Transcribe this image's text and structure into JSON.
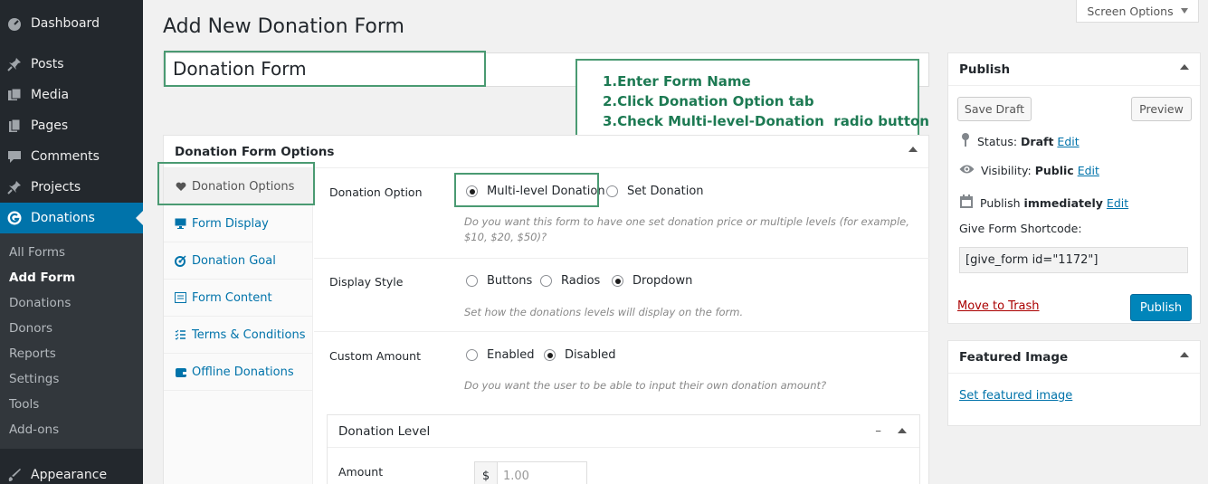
{
  "sidebar": {
    "items": [
      {
        "label": "Dashboard",
        "icon": "dashboard-icon"
      },
      {
        "label": "Posts",
        "icon": "pin-icon"
      },
      {
        "label": "Media",
        "icon": "media-icon"
      },
      {
        "label": "Pages",
        "icon": "pages-icon"
      },
      {
        "label": "Comments",
        "icon": "comments-icon"
      },
      {
        "label": "Projects",
        "icon": "pin-icon"
      },
      {
        "label": "Donations",
        "icon": "give-icon"
      },
      {
        "label": "Appearance",
        "icon": "appearance-icon"
      }
    ],
    "submenu": [
      "All Forms",
      "Add Form",
      "Donations",
      "Donors",
      "Reports",
      "Settings",
      "Tools",
      "Add-ons"
    ],
    "active_color": "#0073aa"
  },
  "header": {
    "title": "Add New Donation Form",
    "screen_options": "Screen Options"
  },
  "form_title": {
    "value": "Donation Form"
  },
  "callout": {
    "lines": [
      "1.Enter Form Name",
      "2.Click Donation Option tab",
      "3.Check Multi-level-Donation  radio button"
    ],
    "border_color": "#4a9a72"
  },
  "options_box": {
    "title": "Donation Form Options",
    "tabs": [
      {
        "label": "Donation Options",
        "icon": "heart-icon"
      },
      {
        "label": "Form Display",
        "icon": "display-icon"
      },
      {
        "label": "Donation Goal",
        "icon": "goal-icon"
      },
      {
        "label": "Form Content",
        "icon": "content-icon"
      },
      {
        "label": "Terms & Conditions",
        "icon": "list-icon"
      },
      {
        "label": "Offline Donations",
        "icon": "wallet-icon"
      }
    ],
    "donation_option": {
      "label": "Donation Option",
      "options": [
        "Multi-level Donation",
        "Set Donation"
      ],
      "selected": "Multi-level Donation",
      "description": "Do you want this form to have one set donation price or multiple levels (for example, $10, $20, $50)?"
    },
    "display_style": {
      "label": "Display Style",
      "options": [
        "Buttons",
        "Radios",
        "Dropdown"
      ],
      "selected": "Dropdown",
      "description": "Set how the donations levels will display on the form."
    },
    "custom_amount": {
      "label": "Custom Amount",
      "options": [
        "Enabled",
        "Disabled"
      ],
      "selected": "Disabled",
      "description": "Do you want the user to be able to input their own donation amount?"
    },
    "donation_level": {
      "title": "Donation Level",
      "collapse": "–",
      "amount_label": "Amount",
      "currency": "$",
      "amount_placeholder": "1.00"
    }
  },
  "publish": {
    "title": "Publish",
    "save_draft": "Save Draft",
    "preview": "Preview",
    "status_label": "Status:",
    "status_value": "Draft",
    "visibility_label": "Visibility:",
    "visibility_value": "Public",
    "publish_label": "Publish",
    "publish_value": "immediately",
    "edit": "Edit",
    "shortcode_label": "Give Form Shortcode:",
    "shortcode": "[give_form id=\"1172\"]",
    "trash": "Move to Trash",
    "publish_button": "Publish"
  },
  "featured_image": {
    "title": "Featured Image",
    "link": "Set featured image"
  }
}
